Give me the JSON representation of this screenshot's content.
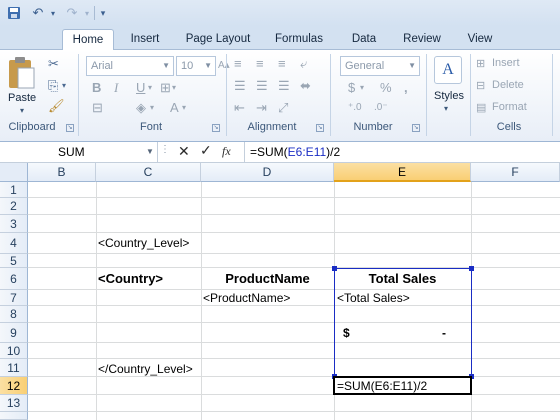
{
  "quick_access": {
    "customize_glyph": "▾"
  },
  "tabs": [
    "Home",
    "Insert",
    "Page Layout",
    "Formulas",
    "Data",
    "Review",
    "View"
  ],
  "ribbon": {
    "clipboard": {
      "label": "Clipboard",
      "paste_label": "Paste"
    },
    "font": {
      "label": "Font",
      "font_name": "Arial",
      "font_size": "10",
      "bold": "B",
      "italic": "I",
      "underline": "U"
    },
    "alignment": {
      "label": "Alignment"
    },
    "number": {
      "label": "Number",
      "format": "General",
      "currency": "$",
      "percent": "%",
      "comma": ","
    },
    "styles": {
      "label": "Styles"
    },
    "cells": {
      "label": "Cells",
      "insert": "Insert",
      "delete": "Delete",
      "format": "Format"
    }
  },
  "formula_bar": {
    "name_box": "SUM",
    "fx": "fx",
    "formula_prefix": "=SUM(",
    "formula_ref": "E6:E11",
    "formula_suffix": ")/2"
  },
  "columns": [
    "B",
    "C",
    "D",
    "E",
    "F"
  ],
  "selected_column": "E",
  "rows": [
    "1",
    "2",
    "3",
    "4",
    "5",
    "6",
    "7",
    "8",
    "9",
    "10",
    "11",
    "12",
    "13"
  ],
  "selected_row": "12",
  "cells": {
    "c4": "<Country_Level>",
    "c6": "<Country>",
    "d6": "ProductName",
    "e6": "Total Sales",
    "d7": "<ProductName>",
    "e7": "<Total Sales>",
    "e9_currency": "$",
    "e9_value": "-",
    "c11": "</Country_Level>",
    "e12": "=SUM(E6:E11)/2"
  },
  "colors": {
    "accent": "#1f4e8c",
    "range_border": "#1a2dc4",
    "selected_header": "#f9cf74",
    "ref_text": "#1a2dc4"
  }
}
